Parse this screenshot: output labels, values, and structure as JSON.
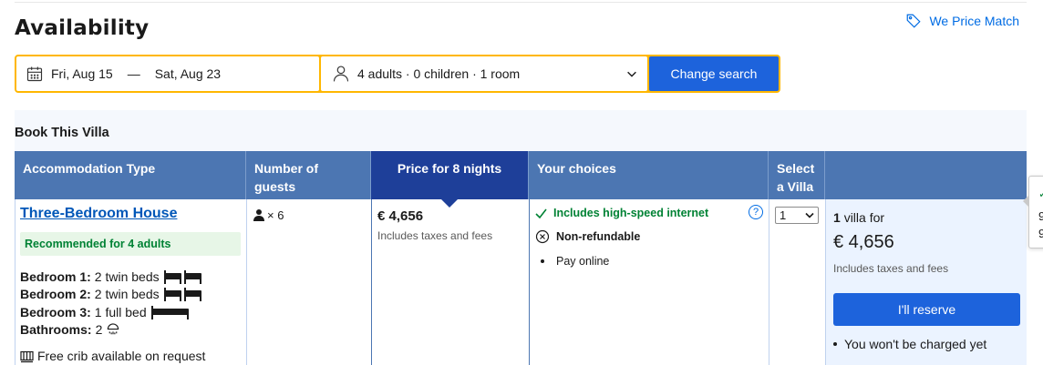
{
  "header": {
    "title": "Availability",
    "price_match": "We Price Match"
  },
  "search": {
    "checkin": "Fri, Aug 15",
    "separator": "—",
    "checkout": "Sat, Aug 23",
    "guests": "4 adults · 0 children · 1 room",
    "button": "Change search"
  },
  "section_title": "Book This Villa",
  "table": {
    "headers": {
      "accommodation": "Accommodation Type",
      "guests": "Number of guests",
      "price": "Price for 8 nights",
      "choices": "Your choices",
      "select": "Select a Villa"
    },
    "row": {
      "room_name": "Three-Bedroom House",
      "recommendation": "Recommended for 4 adults",
      "bedrooms": [
        {
          "label": "Bedroom 1:",
          "value": "2 twin beds",
          "icon": "twin-beds-icon"
        },
        {
          "label": "Bedroom 2:",
          "value": "2 twin beds",
          "icon": "twin-beds-icon"
        },
        {
          "label": "Bedroom 3:",
          "value": "1 full bed",
          "icon": "full-bed-icon"
        }
      ],
      "bathrooms_label": "Bathrooms:",
      "bathrooms_value": "2",
      "crib": "Free crib available on request",
      "guest_count": "× 6",
      "price": "€ 4,656",
      "price_note": "Includes taxes and fees",
      "choices": {
        "internet": "Includes high-speed internet",
        "refund": "Non-refundable",
        "payment": "Pay online"
      },
      "select_value": "1"
    },
    "summary": {
      "count": "1",
      "unit": "villa for",
      "price": "€ 4,656",
      "note": "Includes taxes and fees",
      "reserve": "I'll reserve",
      "bullet": "You won't be charged yet"
    }
  },
  "side_popup": {
    "line1": "9",
    "line2": "9"
  },
  "colors": {
    "brand_blue": "#1d63dc",
    "header_blue": "#4c76b2",
    "price_header": "#1e3f99",
    "search_border": "#ffb700",
    "green": "#008234",
    "link": "#0057b8"
  }
}
